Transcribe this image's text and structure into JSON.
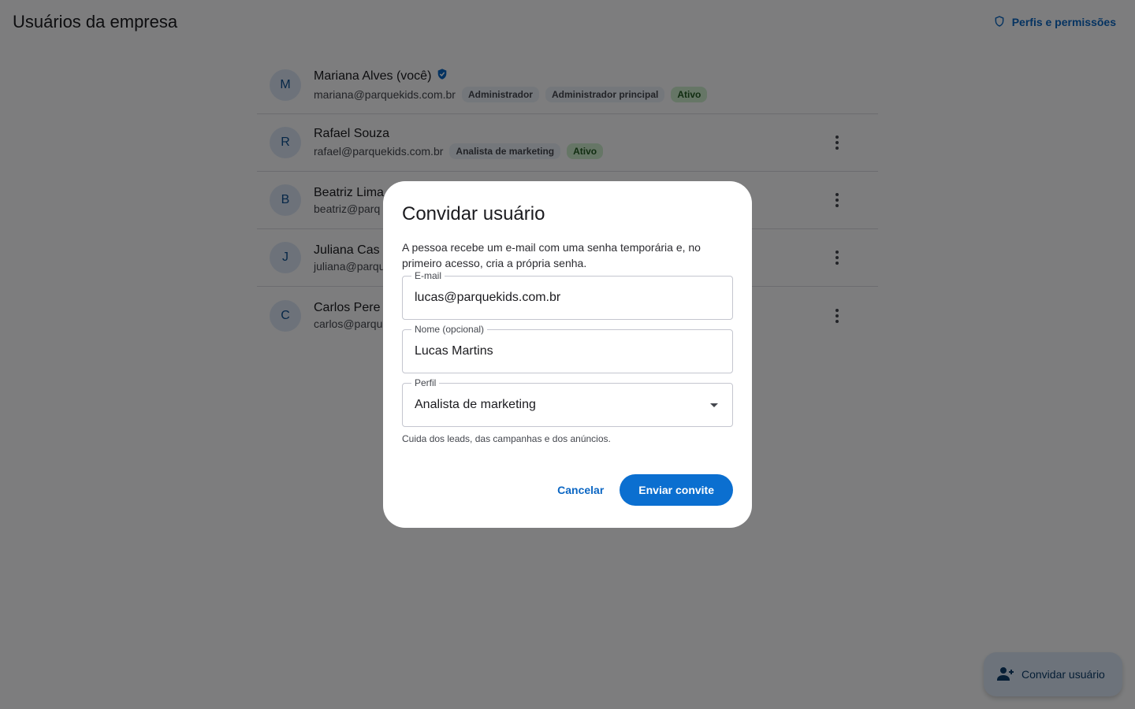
{
  "header": {
    "title": "Usuários da empresa",
    "permissions_link": "Perfis e permissões"
  },
  "users": [
    {
      "initial": "M",
      "name": "Mariana Alves (você)",
      "verified": true,
      "email": "mariana@parquekids.com.br",
      "roles": [
        "Administrador",
        "Administrador principal"
      ],
      "status": "Ativo"
    },
    {
      "initial": "R",
      "name": "Rafael Souza",
      "verified": false,
      "email": "rafael@parquekids.com.br",
      "roles": [
        "Analista de marketing"
      ],
      "status": "Ativo"
    },
    {
      "initial": "B",
      "name": "Beatriz Lima",
      "verified": false,
      "email": "beatriz@parq",
      "roles": [],
      "status": ""
    },
    {
      "initial": "J",
      "name": "Juliana Cas",
      "verified": false,
      "email": "juliana@parqu",
      "roles": [],
      "status": ""
    },
    {
      "initial": "C",
      "name": "Carlos Pere",
      "verified": false,
      "email": "carlos@parqu",
      "roles": [],
      "status": ""
    }
  ],
  "fab": {
    "label": "Convidar usuário"
  },
  "dialog": {
    "title": "Convidar usuário",
    "description": "A pessoa recebe um e-mail com uma senha temporária e, no primeiro acesso, cria a própria senha.",
    "email": {
      "label": "E-mail",
      "value": "lucas@parquekids.com.br"
    },
    "name": {
      "label": "Nome (opcional)",
      "value": "Lucas Martins"
    },
    "profile": {
      "label": "Perfil",
      "value": "Analista de marketing",
      "helper": "Cuida dos leads, das campanhas e dos anúncios."
    },
    "cancel_label": "Cancelar",
    "submit_label": "Enviar convite"
  },
  "colors": {
    "accent": "#0b6fd0",
    "link": "#0b66c3",
    "active_chip_bg": "#cdeccd",
    "scrim": "rgba(0,0,0,0.5)"
  },
  "icons": {
    "permissions": "shield-icon",
    "verified": "verified-badge-icon",
    "row_menu": "more-vertical-icon",
    "fab": "person-add-icon",
    "select": "arrow-drop-down-icon"
  }
}
